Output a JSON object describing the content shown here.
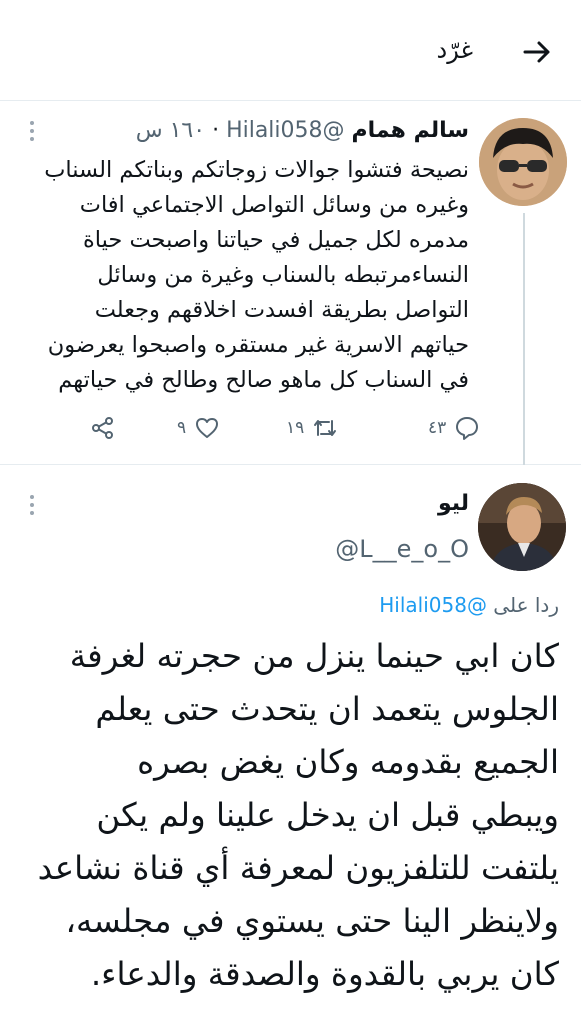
{
  "header": {
    "title": "غرّد",
    "back_icon": "arrow-back-icon"
  },
  "tweet1": {
    "name": "سالم همام",
    "handle": "@Hilali058",
    "time": "١٦٠ س",
    "separator": "·",
    "text": "نصيحة فتشوا جوالات زوجاتكم وبناتكم السناب\nوغيره من وسائل التواصل الاجتماعي  افات\nمدمره لكل جميل في حياتنا واصبحت حياة\nالنساءمرتبطه بالسناب وغيرة من وسائل\nالتواصل بطريقة افسدت اخلاقهم وجعلت\nحياتهم الاسرية غير مستقره واصبحوا يعرضون\nفي السناب كل ماهو صالح وطالح في حياتهم",
    "replies": "٤٣",
    "retweets": "١٩",
    "likes": "٩"
  },
  "tweet2": {
    "name": "ليو",
    "handle": "@L__e_o_O",
    "reply_prefix": "ردا على",
    "reply_handle": "@Hilali058",
    "text": "كان ابي حينما ينزل من حجرته لغرفة\nالجلوس يتعمد ان يتحدث حتى يعلم\nالجميع بقدومه وكان يغض بصره\nويبطي قبل ان يدخل علينا ولم يكن\nيلتفت للتلفزيون لمعرفة أي قناة نشاعد\nولاينظر الينا حتى يستوي في مجلسه،\nكان يربي بالقدوة والصدقة والدعاء."
  },
  "colors": {
    "text": "#0f1419",
    "muted": "#536471",
    "link": "#1d9bf0",
    "divider": "#e6ecf0"
  }
}
